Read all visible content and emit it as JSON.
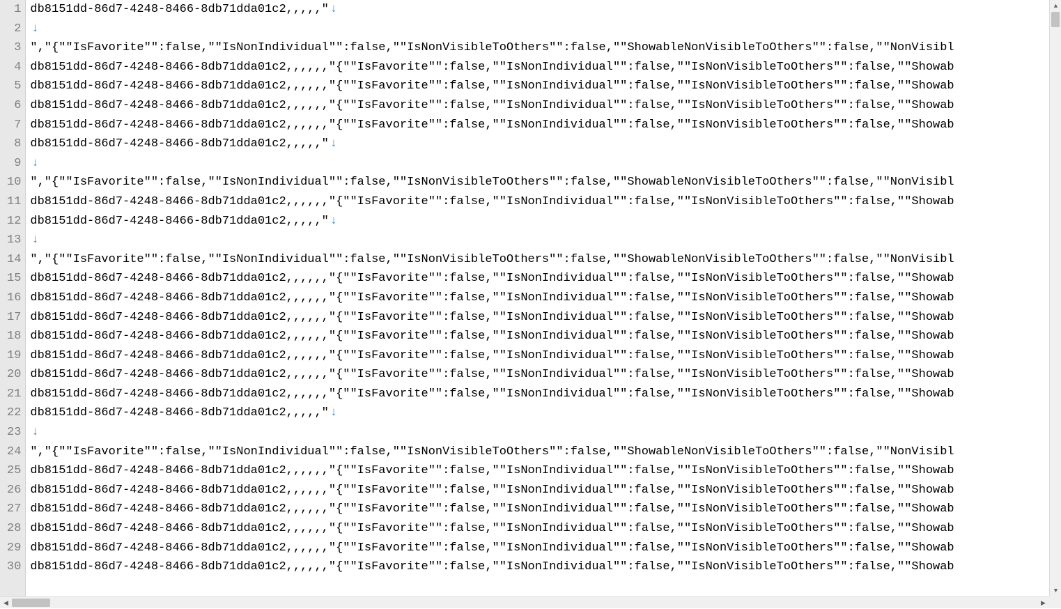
{
  "editor": {
    "eol_glyph": "↓",
    "lines": [
      {
        "num": 1,
        "text": "db8151dd-86d7-4248-8466-8db71dda01c2,,,,,\"",
        "has_eol": true
      },
      {
        "num": 2,
        "text": "",
        "has_eol": true
      },
      {
        "num": 3,
        "text": "\",\"{\"\"IsFavorite\"\":false,\"\"IsNonIndividual\"\":false,\"\"IsNonVisibleToOthers\"\":false,\"\"ShowableNonVisibleToOthers\"\":false,\"\"NonVisibl",
        "has_eol": false
      },
      {
        "num": 4,
        "text": "db8151dd-86d7-4248-8466-8db71dda01c2,,,,,,\"{\"\"IsFavorite\"\":false,\"\"IsNonIndividual\"\":false,\"\"IsNonVisibleToOthers\"\":false,\"\"Showab",
        "has_eol": false
      },
      {
        "num": 5,
        "text": "db8151dd-86d7-4248-8466-8db71dda01c2,,,,,,\"{\"\"IsFavorite\"\":false,\"\"IsNonIndividual\"\":false,\"\"IsNonVisibleToOthers\"\":false,\"\"Showab",
        "has_eol": false
      },
      {
        "num": 6,
        "text": "db8151dd-86d7-4248-8466-8db71dda01c2,,,,,,\"{\"\"IsFavorite\"\":false,\"\"IsNonIndividual\"\":false,\"\"IsNonVisibleToOthers\"\":false,\"\"Showab",
        "has_eol": false
      },
      {
        "num": 7,
        "text": "db8151dd-86d7-4248-8466-8db71dda01c2,,,,,,\"{\"\"IsFavorite\"\":false,\"\"IsNonIndividual\"\":false,\"\"IsNonVisibleToOthers\"\":false,\"\"Showab",
        "has_eol": false
      },
      {
        "num": 8,
        "text": "db8151dd-86d7-4248-8466-8db71dda01c2,,,,,\"",
        "has_eol": true
      },
      {
        "num": 9,
        "text": "",
        "has_eol": true
      },
      {
        "num": 10,
        "text": "\",\"{\"\"IsFavorite\"\":false,\"\"IsNonIndividual\"\":false,\"\"IsNonVisibleToOthers\"\":false,\"\"ShowableNonVisibleToOthers\"\":false,\"\"NonVisibl",
        "has_eol": false
      },
      {
        "num": 11,
        "text": "db8151dd-86d7-4248-8466-8db71dda01c2,,,,,,\"{\"\"IsFavorite\"\":false,\"\"IsNonIndividual\"\":false,\"\"IsNonVisibleToOthers\"\":false,\"\"Showab",
        "has_eol": false
      },
      {
        "num": 12,
        "text": "db8151dd-86d7-4248-8466-8db71dda01c2,,,,,\"",
        "has_eol": true
      },
      {
        "num": 13,
        "text": "",
        "has_eol": true
      },
      {
        "num": 14,
        "text": "\",\"{\"\"IsFavorite\"\":false,\"\"IsNonIndividual\"\":false,\"\"IsNonVisibleToOthers\"\":false,\"\"ShowableNonVisibleToOthers\"\":false,\"\"NonVisibl",
        "has_eol": false
      },
      {
        "num": 15,
        "text": "db8151dd-86d7-4248-8466-8db71dda01c2,,,,,,\"{\"\"IsFavorite\"\":false,\"\"IsNonIndividual\"\":false,\"\"IsNonVisibleToOthers\"\":false,\"\"Showab",
        "has_eol": false
      },
      {
        "num": 16,
        "text": "db8151dd-86d7-4248-8466-8db71dda01c2,,,,,,\"{\"\"IsFavorite\"\":false,\"\"IsNonIndividual\"\":false,\"\"IsNonVisibleToOthers\"\":false,\"\"Showab",
        "has_eol": false
      },
      {
        "num": 17,
        "text": "db8151dd-86d7-4248-8466-8db71dda01c2,,,,,,\"{\"\"IsFavorite\"\":false,\"\"IsNonIndividual\"\":false,\"\"IsNonVisibleToOthers\"\":false,\"\"Showab",
        "has_eol": false
      },
      {
        "num": 18,
        "text": "db8151dd-86d7-4248-8466-8db71dda01c2,,,,,,\"{\"\"IsFavorite\"\":false,\"\"IsNonIndividual\"\":false,\"\"IsNonVisibleToOthers\"\":false,\"\"Showab",
        "has_eol": false
      },
      {
        "num": 19,
        "text": "db8151dd-86d7-4248-8466-8db71dda01c2,,,,,,\"{\"\"IsFavorite\"\":false,\"\"IsNonIndividual\"\":false,\"\"IsNonVisibleToOthers\"\":false,\"\"Showab",
        "has_eol": false
      },
      {
        "num": 20,
        "text": "db8151dd-86d7-4248-8466-8db71dda01c2,,,,,,\"{\"\"IsFavorite\"\":false,\"\"IsNonIndividual\"\":false,\"\"IsNonVisibleToOthers\"\":false,\"\"Showab",
        "has_eol": false
      },
      {
        "num": 21,
        "text": "db8151dd-86d7-4248-8466-8db71dda01c2,,,,,,\"{\"\"IsFavorite\"\":false,\"\"IsNonIndividual\"\":false,\"\"IsNonVisibleToOthers\"\":false,\"\"Showab",
        "has_eol": false
      },
      {
        "num": 22,
        "text": "db8151dd-86d7-4248-8466-8db71dda01c2,,,,,\"",
        "has_eol": true
      },
      {
        "num": 23,
        "text": "",
        "has_eol": true
      },
      {
        "num": 24,
        "text": "\",\"{\"\"IsFavorite\"\":false,\"\"IsNonIndividual\"\":false,\"\"IsNonVisibleToOthers\"\":false,\"\"ShowableNonVisibleToOthers\"\":false,\"\"NonVisibl",
        "has_eol": false
      },
      {
        "num": 25,
        "text": "db8151dd-86d7-4248-8466-8db71dda01c2,,,,,,\"{\"\"IsFavorite\"\":false,\"\"IsNonIndividual\"\":false,\"\"IsNonVisibleToOthers\"\":false,\"\"Showab",
        "has_eol": false
      },
      {
        "num": 26,
        "text": "db8151dd-86d7-4248-8466-8db71dda01c2,,,,,,\"{\"\"IsFavorite\"\":false,\"\"IsNonIndividual\"\":false,\"\"IsNonVisibleToOthers\"\":false,\"\"Showab",
        "has_eol": false
      },
      {
        "num": 27,
        "text": "db8151dd-86d7-4248-8466-8db71dda01c2,,,,,,\"{\"\"IsFavorite\"\":false,\"\"IsNonIndividual\"\":false,\"\"IsNonVisibleToOthers\"\":false,\"\"Showab",
        "has_eol": false
      },
      {
        "num": 28,
        "text": "db8151dd-86d7-4248-8466-8db71dda01c2,,,,,,\"{\"\"IsFavorite\"\":false,\"\"IsNonIndividual\"\":false,\"\"IsNonVisibleToOthers\"\":false,\"\"Showab",
        "has_eol": false
      },
      {
        "num": 29,
        "text": "db8151dd-86d7-4248-8466-8db71dda01c2,,,,,,\"{\"\"IsFavorite\"\":false,\"\"IsNonIndividual\"\":false,\"\"IsNonVisibleToOthers\"\":false,\"\"Showab",
        "has_eol": false
      },
      {
        "num": 30,
        "text": "db8151dd-86d7-4248-8466-8db71dda01c2,,,,,,\"{\"\"IsFavorite\"\":false,\"\"IsNonIndividual\"\":false,\"\"IsNonVisibleToOthers\"\":false,\"\"Showab",
        "has_eol": false
      }
    ]
  }
}
